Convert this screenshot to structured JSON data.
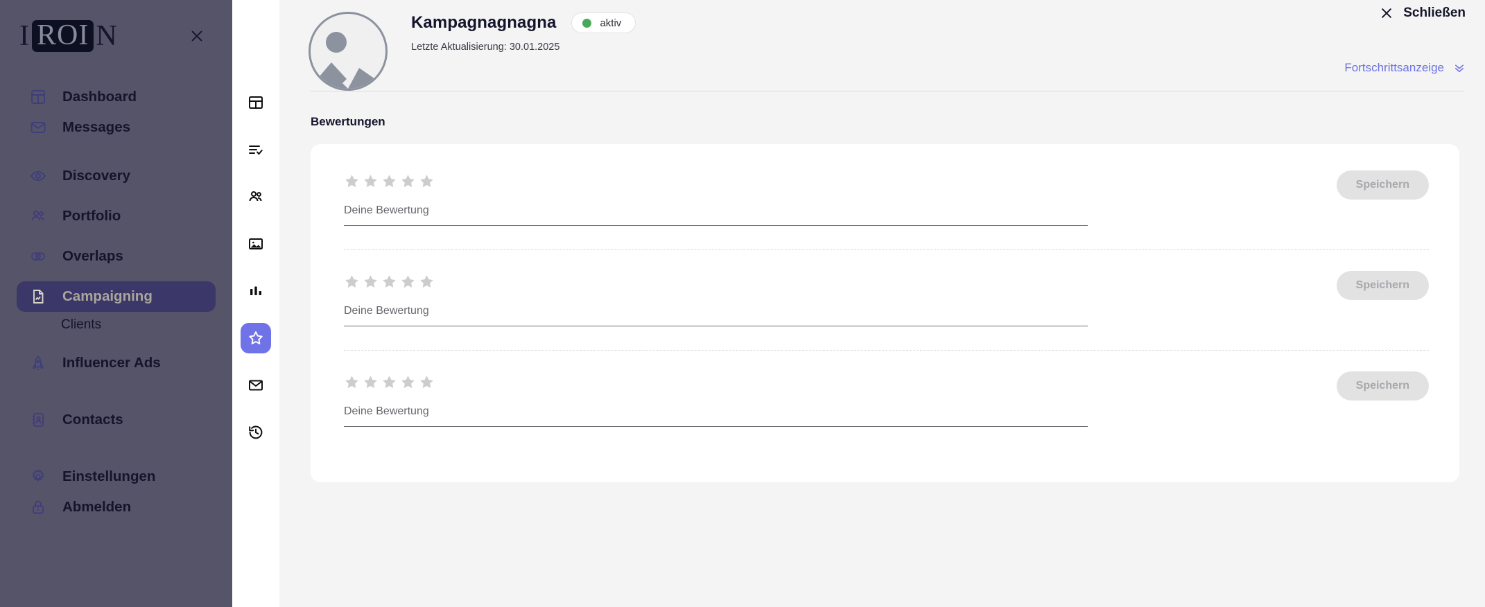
{
  "sidebar": {
    "logo": {
      "prefix": "I",
      "boxed": "ROI",
      "suffix": "N"
    },
    "close_icon": "close-icon",
    "items": [
      {
        "label": "Dashboard",
        "icon": "dashboard-icon",
        "active": false
      },
      {
        "label": "Messages",
        "icon": "mail-icon",
        "active": false
      },
      {
        "label": "Discovery",
        "icon": "eye-icon",
        "active": false
      },
      {
        "label": "Portfolio",
        "icon": "people-icon",
        "active": false
      },
      {
        "label": "Overlaps",
        "icon": "overlap-circles-icon",
        "active": false
      },
      {
        "label": "Campaigning",
        "icon": "document-chart-icon",
        "active": true
      },
      {
        "label": "Influencer Ads",
        "icon": "rocket-icon",
        "active": false
      },
      {
        "label": "Contacts",
        "icon": "contact-card-icon",
        "active": false
      },
      {
        "label": "Einstellungen",
        "icon": "gear-icon",
        "active": false
      },
      {
        "label": "Abmelden",
        "icon": "lock-icon",
        "active": false
      }
    ],
    "sub_item": {
      "label": "Clients"
    },
    "colors": {
      "background": "#565469",
      "active_background": "#3b3768",
      "active_text": "#a9a79a"
    }
  },
  "icon_rail": {
    "items": [
      {
        "name": "layout-icon",
        "active": false
      },
      {
        "name": "list-check-icon",
        "active": false
      },
      {
        "name": "people-icon",
        "active": false
      },
      {
        "name": "image-icon",
        "active": false
      },
      {
        "name": "bar-chart-icon",
        "active": false
      },
      {
        "name": "star-icon",
        "active": true
      },
      {
        "name": "mail-icon",
        "active": false
      },
      {
        "name": "history-icon",
        "active": false
      }
    ],
    "active_color": "#7073e8"
  },
  "header": {
    "avatar_icon": "image-placeholder-icon",
    "campaign_title": "Kampagnagnagna",
    "status_badge": {
      "label": "aktiv",
      "dot_color": "#4aa85a"
    },
    "last_updated": "Letzte Aktualisierung: 30.01.2025",
    "close_label": "Schließen",
    "close_icon": "close-icon",
    "progress_label": "Fortschrittsanzeige",
    "progress_icon": "chevron-double-down-icon",
    "progress_color": "#6e72e0"
  },
  "main": {
    "section_title": "Bewertungen",
    "ratings": [
      {
        "stars_filled": 0,
        "stars_total": 5,
        "input_value": "",
        "input_placeholder": "Deine Bewertung",
        "save_label": "Speichern",
        "save_disabled": true
      },
      {
        "stars_filled": 0,
        "stars_total": 5,
        "input_value": "",
        "input_placeholder": "Deine Bewertung",
        "save_label": "Speichern",
        "save_disabled": true
      },
      {
        "stars_filled": 0,
        "stars_total": 5,
        "input_value": "",
        "input_placeholder": "Deine Bewertung",
        "save_label": "Speichern",
        "save_disabled": true
      }
    ],
    "star_color": "#cdcdcf",
    "page_background": "#f4f4f5",
    "card_background": "#ffffff"
  }
}
